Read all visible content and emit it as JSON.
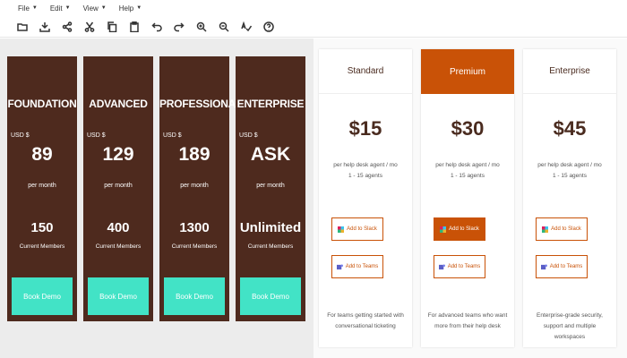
{
  "menu": [
    {
      "label": "File"
    },
    {
      "label": "Edit"
    },
    {
      "label": "View"
    },
    {
      "label": "Help"
    }
  ],
  "toolbar_icons": [
    "open-folder",
    "download",
    "share",
    "cut",
    "copy",
    "paste",
    "undo",
    "redo",
    "zoom-in",
    "zoom-out",
    "spell-check",
    "help"
  ],
  "colors": {
    "dark_card": "#4e2a1e",
    "teal_button": "#42e3c6",
    "accent_orange": "#c95207",
    "left_bg": "#ececec"
  },
  "dark_plans": [
    {
      "name": "FOUNDATION",
      "currency": "USD $",
      "price": "89",
      "period": "per month",
      "members": "150",
      "members_label": "Current Members",
      "button": "Book Demo"
    },
    {
      "name": "ADVANCED",
      "currency": "USD $",
      "price": "129",
      "period": "per month",
      "members": "400",
      "members_label": "Current Members",
      "button": "Book Demo"
    },
    {
      "name": "PROFESSIONAL",
      "currency": "USD $",
      "price": "189",
      "period": "per month",
      "members": "1300",
      "members_label": "Current Members",
      "button": "Book Demo"
    },
    {
      "name": "ENTERPRISE",
      "currency": "USD $",
      "price": "ASK",
      "period": "per month",
      "members": "Unlimited",
      "members_label": "Current Members",
      "button": "Book Demo"
    }
  ],
  "light_plans": [
    {
      "name": "Standard",
      "price": "$15",
      "desc1": "per help desk agent / mo",
      "desc2": "1 - 15 agents",
      "slack": "Add to Slack",
      "teams": "Add to Teams",
      "bottom": "For teams getting started with conversational ticketing"
    },
    {
      "name": "Premium",
      "price": "$30",
      "desc1": "per help desk agent / mo",
      "desc2": "1 - 15 agents",
      "slack": "Add to Slack",
      "teams": "Add to Teams",
      "bottom": "For advanced teams who want more from their help desk"
    },
    {
      "name": "Enterprise",
      "price": "$45",
      "desc1": "per help desk agent / mo",
      "desc2": "1 - 15 agents",
      "slack": "Add to Slack",
      "teams": "Add to Teams",
      "bottom": "Enterprise-grade security, support and multiple workspaces"
    }
  ]
}
